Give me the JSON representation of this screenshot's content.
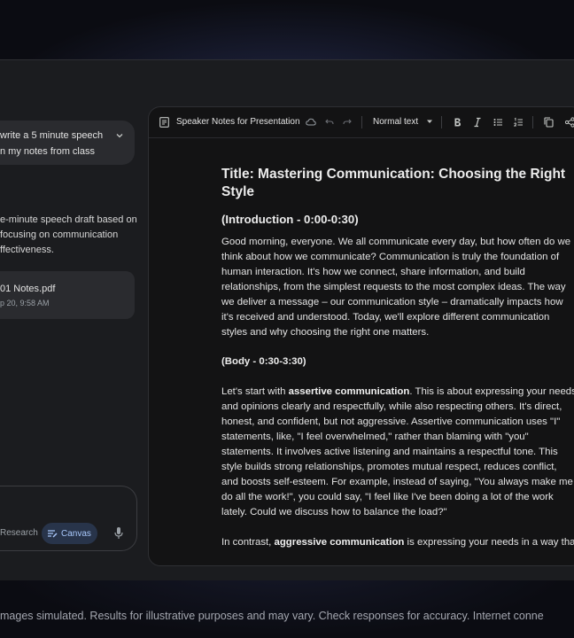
{
  "chat": {
    "prompt_lines": [
      "write a 5 minute speech",
      "n my notes from class"
    ],
    "response_lines": [
      "e-minute speech draft based on",
      "focusing on communication",
      "ffectiveness."
    ],
    "file": {
      "name": "01 Notes.pdf",
      "date": "p 20, 9:58 AM"
    },
    "tools": {
      "research": "Research",
      "canvas": "Canvas"
    }
  },
  "document": {
    "title": "Speaker Notes for Presentation",
    "style_select": "Normal text",
    "heading_lines": [
      "Title: Mastering Communication: Choosing the Right",
      "Style"
    ],
    "intro_heading": "(Introduction - 0:00-0:30)",
    "intro_lines": [
      "Good morning, everyone. We all communicate every day, but how often do we",
      "think about how we communicate? Communication is truly the foundation of",
      "human interaction. It's how we connect, share information, and build",
      "relationships, from the simplest requests to the most complex ideas. The way",
      "we deliver a message – our communication style – dramatically impacts how",
      "it's received and understood. Today, we'll explore different communication",
      "styles and why choosing the right one matters."
    ],
    "body_heading": "(Body - 0:30-3:30)",
    "body_p1": {
      "line1_pre": "Let's start with ",
      "line1_bold": "assertive communication",
      "line1_post": ". This is about expressing your needs",
      "lines": [
        "and opinions clearly and respectfully, while also respecting others. It's direct,",
        "honest, and confident, but not aggressive. Assertive communication uses \"I\"",
        "statements, like, \"I feel overwhelmed,\" rather than blaming with \"you\"",
        "statements. It involves active listening and maintains a respectful tone. This",
        "style builds strong relationships, promotes mutual respect, reduces conflict,",
        "and boosts self-esteem. For example, instead of saying, \"You always make me",
        "do all the work!\", you could say, \"I feel like I've been doing a lot of the work",
        "lately. Could we discuss how to balance the load?\""
      ]
    },
    "body_p2": {
      "pre": "In contrast, ",
      "bold": "aggressive communication",
      "post": " is expressing your needs in a way that"
    }
  },
  "disclaimer": "mages simulated. Results for illustrative purposes and may vary. Check responses for accuracy. Internet conne",
  "colors": {
    "background": "#0b0c12",
    "window": "#1b1c1f",
    "doc": "#131314",
    "accent": "#a8c7fa"
  }
}
